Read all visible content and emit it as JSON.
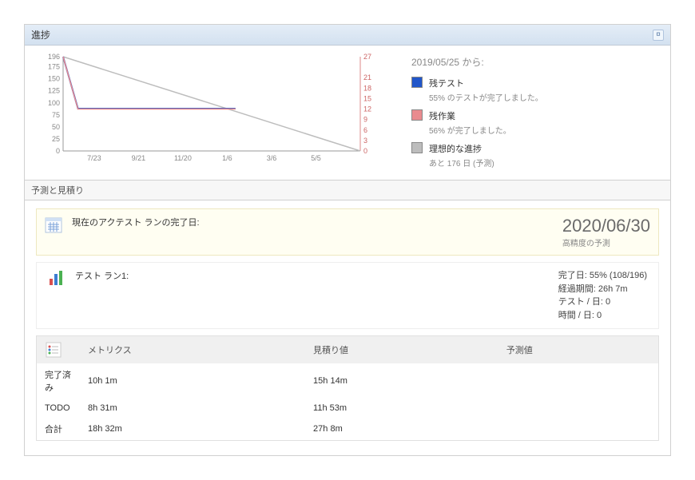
{
  "progress": {
    "title": "進捗",
    "fromLabel": "2019/05/25 から:",
    "legend": [
      {
        "color": "#2156c9",
        "title": "残テスト",
        "sub": "55% のテストが完了しました。"
      },
      {
        "color": "#e98b8f",
        "title": "残作業",
        "sub": "56% が完了しました。"
      },
      {
        "color": "#bdbdbd",
        "title": "理想的な進捗",
        "sub": "あと 176 日 (予測)"
      }
    ]
  },
  "forecastHeader": "予測と見積り",
  "completion": {
    "label": "現在のアクテスト ランの完了日:",
    "date": "2020/06/30",
    "sub": "高精度の予測"
  },
  "testRun": {
    "label": "テスト ラン1:",
    "lines": [
      "完了日: 55% (108/196)",
      "経過期間: 26h 7m",
      "テスト / 日: 0",
      "時間 / 日: 0"
    ]
  },
  "metrics": {
    "col0": "メトリクス",
    "col1": "見積り値",
    "col2": "予測値",
    "rows": [
      {
        "c0": "完了済み",
        "c1": "10h 1m",
        "c2": "15h 14m"
      },
      {
        "c0": "TODO",
        "c1": "8h 31m",
        "c2": "11h 53m"
      },
      {
        "c0": "合計",
        "c1": "18h 32m",
        "c2": "27h 8m"
      }
    ]
  },
  "chart_data": {
    "type": "line",
    "x_ticks": [
      "7/23",
      "9/21",
      "11/20",
      "1/6",
      "3/6",
      "5/5"
    ],
    "y_left": {
      "label": "",
      "ticks": [
        0,
        25,
        50,
        75,
        100,
        125,
        150,
        175,
        196
      ]
    },
    "y_right": {
      "label": "",
      "ticks": [
        0,
        3,
        6,
        9,
        12,
        15,
        18,
        21,
        27
      ]
    },
    "series": [
      {
        "name": "理想的な進捗",
        "color": "#bdbdbd",
        "axis": "left",
        "points": [
          {
            "x": "5/25",
            "y": 196
          },
          {
            "x": "end",
            "y": 0
          }
        ]
      },
      {
        "name": "残テスト",
        "color": "#2156c9",
        "axis": "left",
        "points": [
          {
            "x": "5/25",
            "y": 196
          },
          {
            "x": "6/10",
            "y": 88
          },
          {
            "x": "1/20",
            "y": 88
          }
        ]
      },
      {
        "name": "残作業",
        "color": "#e98b8f",
        "axis": "right",
        "points": [
          {
            "x": "5/25",
            "y": 27
          },
          {
            "x": "6/10",
            "y": 12
          },
          {
            "x": "1/20",
            "y": 12
          }
        ]
      }
    ]
  }
}
